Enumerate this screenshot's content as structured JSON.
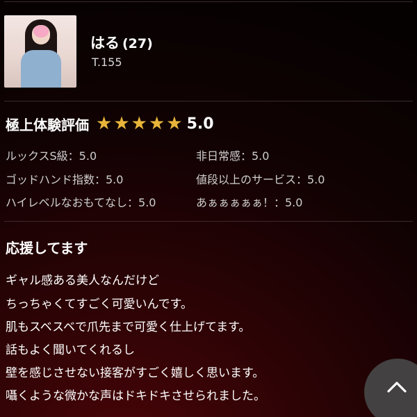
{
  "profile": {
    "name": "はる",
    "age": "(27)",
    "height": "T.155"
  },
  "rating": {
    "title": "極上体験評価",
    "star_count": 5,
    "stars_filled": 5,
    "star_color": "#e8b53a",
    "score": "5.0",
    "items": [
      {
        "label": "ルックスS級：5.0"
      },
      {
        "label": "非日常感：5.0"
      },
      {
        "label": "ゴッドハンド指数：5.0"
      },
      {
        "label": "値段以上のサービス：5.0"
      },
      {
        "label": "ハイレベルなおもてなし：5.0"
      },
      {
        "label": "あぁぁぁぁぁ！：5.0"
      }
    ]
  },
  "comment": {
    "title": "応援してます",
    "lines": [
      "ギャル感ある美人なんだけど",
      "ちっちゃくてすごく可愛いんです。",
      "肌もスベスベで爪先まで可愛く仕上げてます。",
      "話もよく聞いてくれるし",
      "壁を感じさせない接客がすごく嬉しく思います。",
      "囁くような微かな声はドキドキさせられました。"
    ]
  },
  "scroll_top": {
    "icon": "chevron-up-icon"
  },
  "colors": {
    "background_dark": "#110203",
    "background_red": "#4a0508",
    "star": "#e8b53a",
    "text": "#ffffff"
  }
}
